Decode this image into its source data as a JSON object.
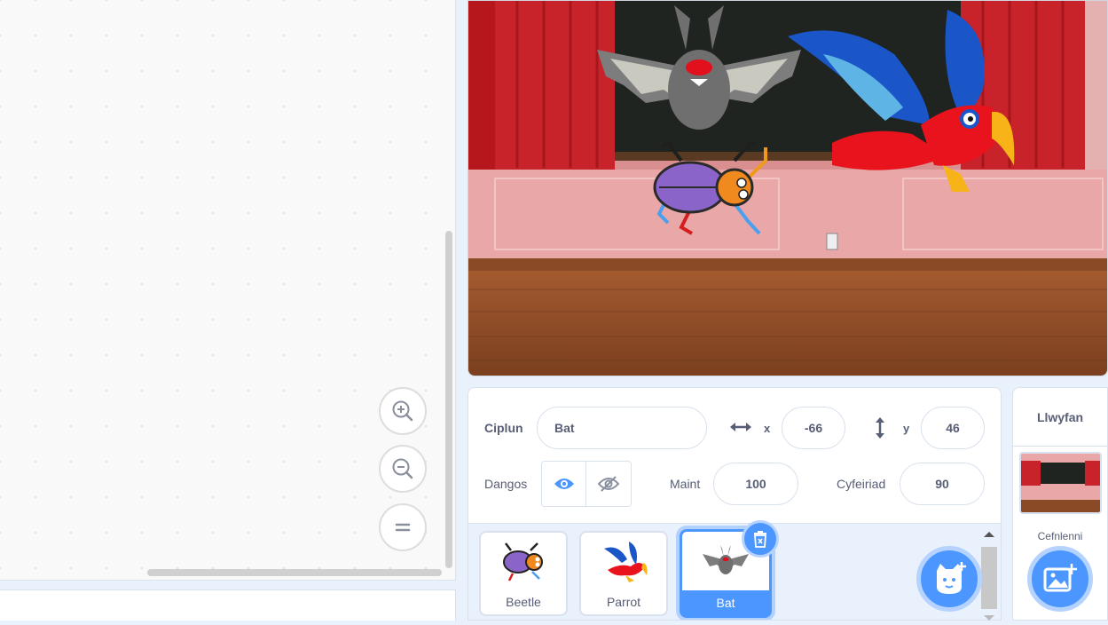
{
  "sprite_info": {
    "sprite_label": "Ciplun",
    "sprite_name": "Bat",
    "x_label": "x",
    "x_value": "-66",
    "y_label": "y",
    "y_value": "46",
    "show_label": "Dangos",
    "size_label": "Maint",
    "size_value": "100",
    "direction_label": "Cyfeiriad",
    "direction_value": "90"
  },
  "sprites": [
    {
      "name": "Beetle",
      "selected": false
    },
    {
      "name": "Parrot",
      "selected": false
    },
    {
      "name": "Bat",
      "selected": true
    }
  ],
  "stage_panel": {
    "title": "Llwyfan",
    "backdrops_label": "Cefnlenni"
  },
  "colors": {
    "accent": "#4c97ff",
    "text": "#575e75"
  },
  "icons": {
    "zoom_in": "zoom-in-icon",
    "zoom_out": "zoom-out-icon",
    "zoom_reset": "zoom-reset-icon",
    "show": "eye-icon",
    "hide": "eye-slash-icon",
    "delete": "trash-icon",
    "choose_sprite": "cat-plus-icon",
    "choose_backdrop": "image-plus-icon"
  }
}
